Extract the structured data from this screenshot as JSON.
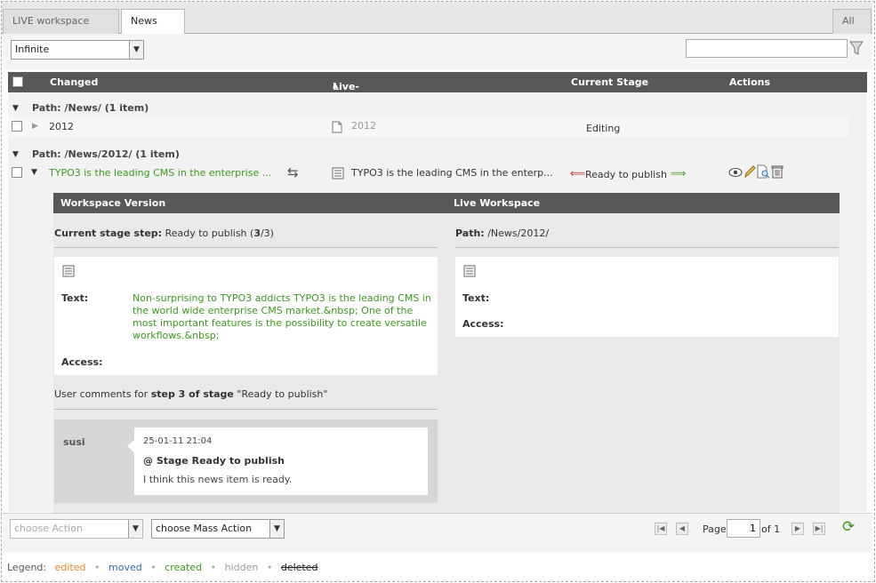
{
  "tabs": {
    "live": "LIVE workspace",
    "news": "News",
    "all": "All"
  },
  "toolbar": {
    "depth_value": "Infinite",
    "search_value": ""
  },
  "grid": {
    "col_changed": "Changed",
    "col_live_title": "Live-Title",
    "col_current_stage": "Current Stage",
    "col_actions": "Actions"
  },
  "groups": [
    {
      "path": "Path: /News/ (1 item)",
      "row": {
        "changed": "2012",
        "live_title": "2012",
        "stage": "Editing"
      }
    },
    {
      "path": "Path: /News/2012/ (1 item)",
      "row": {
        "changed": "TYPO3 is the leading CMS in the enterprise ...",
        "live_title": "TYPO3 is the leading CMS in the enterp...",
        "stage": "Ready to publish"
      }
    }
  ],
  "detail": {
    "header_workspace": "Workspace Version",
    "header_live": "Live Workspace",
    "stage_step_label": "Current stage step:",
    "stage_step_value": "Ready to publish (",
    "stage_step_num": "3",
    "stage_step_total": "/3)",
    "path_label": "Path:",
    "path_value": "/News/2012/",
    "text_label": "Text:",
    "access_label": "Access:",
    "workspace_text": "Non-surprising to TYPO3 addicts TYPO3 is the leading CMS in the world wide enterprise CMS market.&nbsp; One of the most important features is the possibility to create versatile workflows.&nbsp;",
    "comments_prefix": "User comments for ",
    "comments_step": "step 3 of stage",
    "comments_stage": " \"Ready to publish\"",
    "comment": {
      "user": "susi",
      "date": "25-01-11 21:04",
      "title": "@ Stage Ready to publish",
      "body": "I think this news item is ready."
    }
  },
  "bottom": {
    "choose_action": "choose Action",
    "choose_mass_action": "choose Mass Action",
    "page_label": "Page",
    "page_value": "1",
    "of_label": "of 1"
  },
  "legend": {
    "label": "Legend:",
    "edited": "edited",
    "moved": "moved",
    "created": "created",
    "hidden": "hidden",
    "deleted": "deleted"
  },
  "colors": {
    "edited": "#e8872a",
    "moved": "#2f6db5",
    "created": "#3b9a1e",
    "hidden": "#999999",
    "deleted": "#222222"
  }
}
